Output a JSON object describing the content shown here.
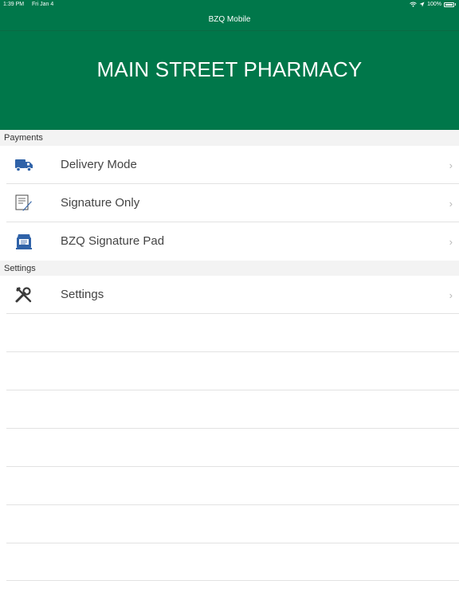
{
  "status_bar": {
    "time": "1:39 PM",
    "date": "Fri Jan 4",
    "battery": "100%"
  },
  "nav": {
    "title": "BZQ Mobile"
  },
  "header": {
    "store_name": "MAIN STREET PHARMACY"
  },
  "colors": {
    "brand": "#00774a",
    "icon_blue": "#2f62a8",
    "section_bg": "#f3f3f3"
  },
  "sections": [
    {
      "label": "Payments",
      "items": [
        {
          "label": "Delivery Mode",
          "icon": "delivery-truck-icon"
        },
        {
          "label": "Signature Only",
          "icon": "signature-icon"
        },
        {
          "label": "BZQ Signature Pad",
          "icon": "signature-pad-icon"
        }
      ]
    },
    {
      "label": "Settings",
      "items": [
        {
          "label": "Settings",
          "icon": "tools-icon"
        }
      ]
    }
  ]
}
